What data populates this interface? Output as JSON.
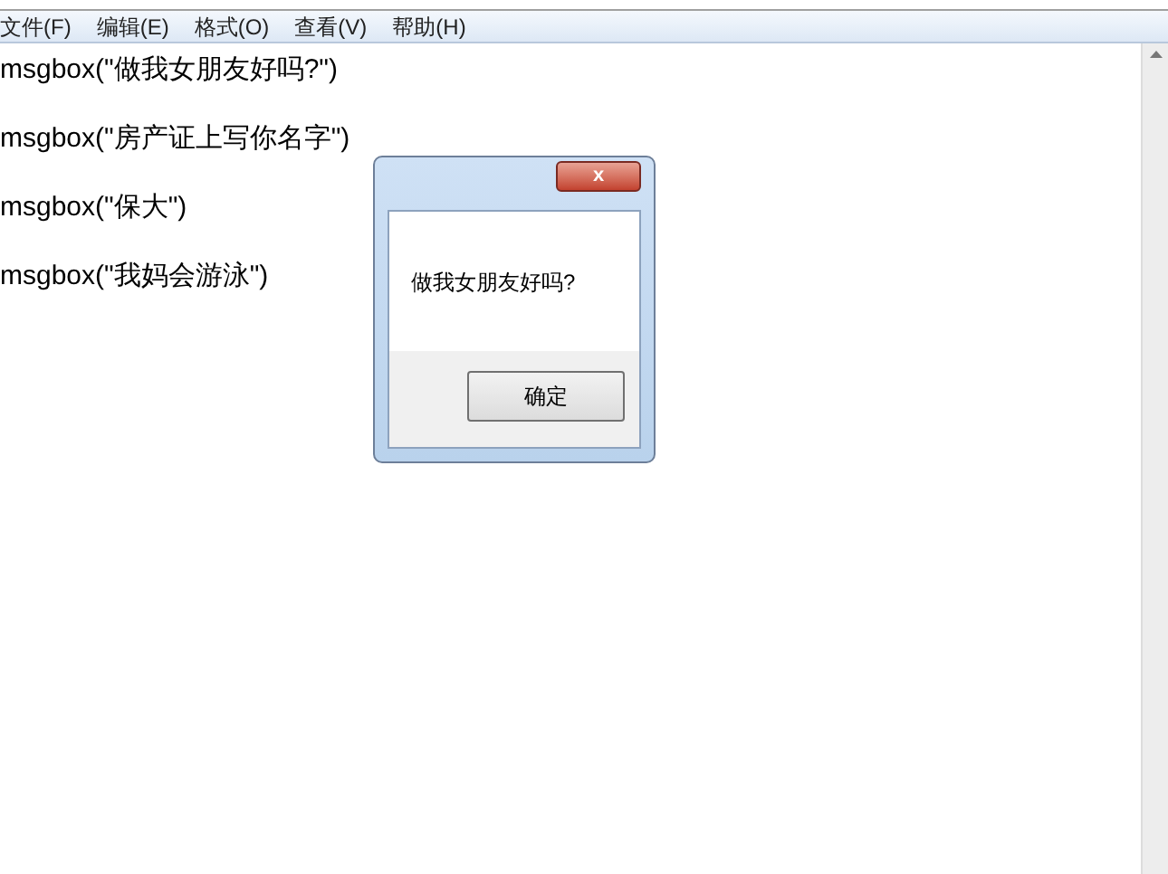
{
  "menu": [
    "文件(F)",
    "编辑(E)",
    "格式(O)",
    "查看(V)",
    "帮助(H)"
  ],
  "lines": [
    "msgbox(\"做我女朋友好吗?\")",
    "msgbox(\"房产证上写你名字\")",
    "msgbox(\"保大\")",
    "msgbox(\"我妈会游泳\")"
  ],
  "dialog": {
    "close": "x",
    "message": "做我女朋友好吗?",
    "button": "确定"
  }
}
